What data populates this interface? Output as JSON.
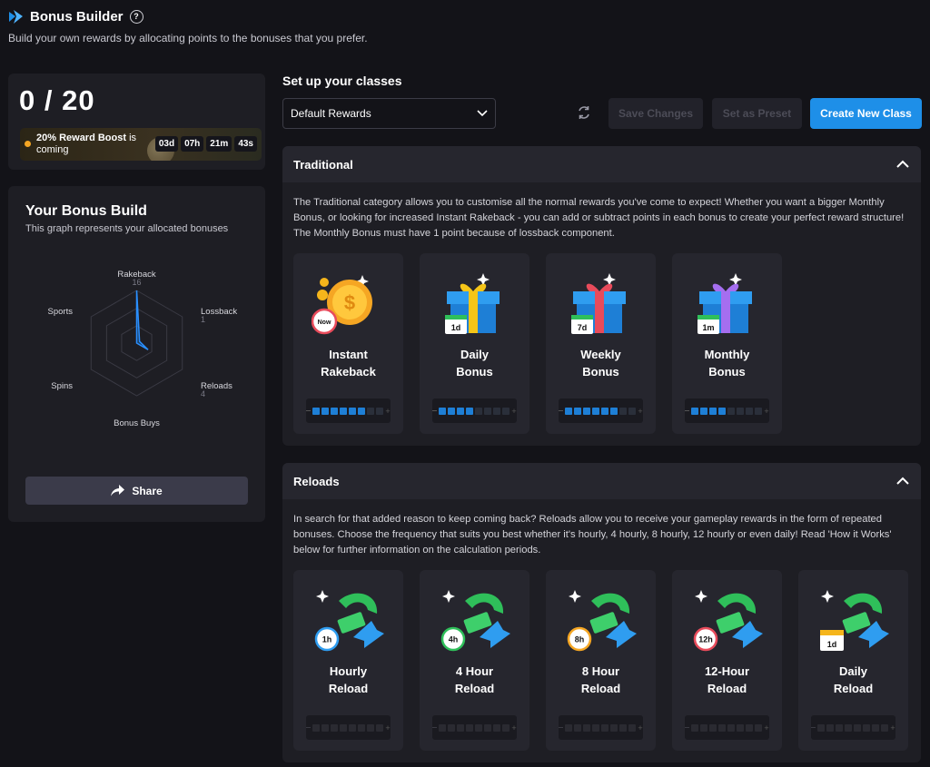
{
  "header": {
    "title": "Bonus Builder",
    "help": "?",
    "subtitle": "Build your own rewards by allocating points to the bonuses that you prefer."
  },
  "points": {
    "value": "0 / 20",
    "boost_bold": "20% Reward Boost",
    "boost_rest": " is coming",
    "timer": [
      "03d",
      "07h",
      "21m",
      "43s"
    ]
  },
  "build": {
    "title": "Your Bonus Build",
    "subtitle": "This graph represents your allocated bonuses",
    "radar": {
      "axes": [
        {
          "label": "Rakeback",
          "value": "16"
        },
        {
          "label": "Lossback",
          "value": "1"
        },
        {
          "label": "Reloads",
          "value": "4"
        },
        {
          "label": "Bonus Buys",
          "value": ""
        },
        {
          "label": "Spins",
          "value": ""
        },
        {
          "label": "Sports",
          "value": ""
        }
      ],
      "values": [
        16,
        1,
        4,
        0,
        0,
        0
      ],
      "max": 16
    },
    "share_label": "Share"
  },
  "setup": {
    "title": "Set up your classes",
    "select_value": "Default Rewards",
    "save_label": "Save Changes",
    "preset_label": "Set as Preset",
    "create_label": "Create New Class"
  },
  "traditional": {
    "title": "Traditional",
    "description": "The Traditional category allows you to customise all the normal rewards you've come to expect! Whether you want a bigger Monthly Bonus, or looking for increased Instant Rakeback - you can add or subtract points in each bonus to create your perfect reward structure! The Monthly Bonus must have 1 point because of lossback component.",
    "cards": [
      {
        "line1": "Instant",
        "line2": "Rakeback",
        "badge": "Now",
        "filled": 6
      },
      {
        "line1": "Daily",
        "line2": "Bonus",
        "badge": "1d",
        "filled": 4
      },
      {
        "line1": "Weekly",
        "line2": "Bonus",
        "badge": "7d",
        "filled": 6
      },
      {
        "line1": "Monthly",
        "line2": "Bonus",
        "badge": "1m",
        "filled": 4
      }
    ]
  },
  "reloads": {
    "title": "Reloads",
    "description": "In search for that added reason to keep coming back? Reloads allow you to receive your gameplay rewards in the form of repeated bonuses. Choose the frequency that suits you best whether it's hourly, 4 hourly, 8 hourly, 12 hourly or even daily! Read 'How it Works' below for further information on the calculation periods.",
    "cards": [
      {
        "line1": "Hourly",
        "line2": "Reload",
        "badge": "1h",
        "filled": 0
      },
      {
        "line1": "4 Hour",
        "line2": "Reload",
        "badge": "4h",
        "filled": 0
      },
      {
        "line1": "8 Hour",
        "line2": "Reload",
        "badge": "8h",
        "filled": 0
      },
      {
        "line1": "12-Hour",
        "line2": "Reload",
        "badge": "12h",
        "filled": 0
      },
      {
        "line1": "Daily",
        "line2": "Reload",
        "badge": "1d",
        "filled": 0
      }
    ]
  },
  "colors": {
    "accent": "#1e8fe8",
    "boost_dot": "#f5a623",
    "meter_on": "#1e7fd6"
  }
}
